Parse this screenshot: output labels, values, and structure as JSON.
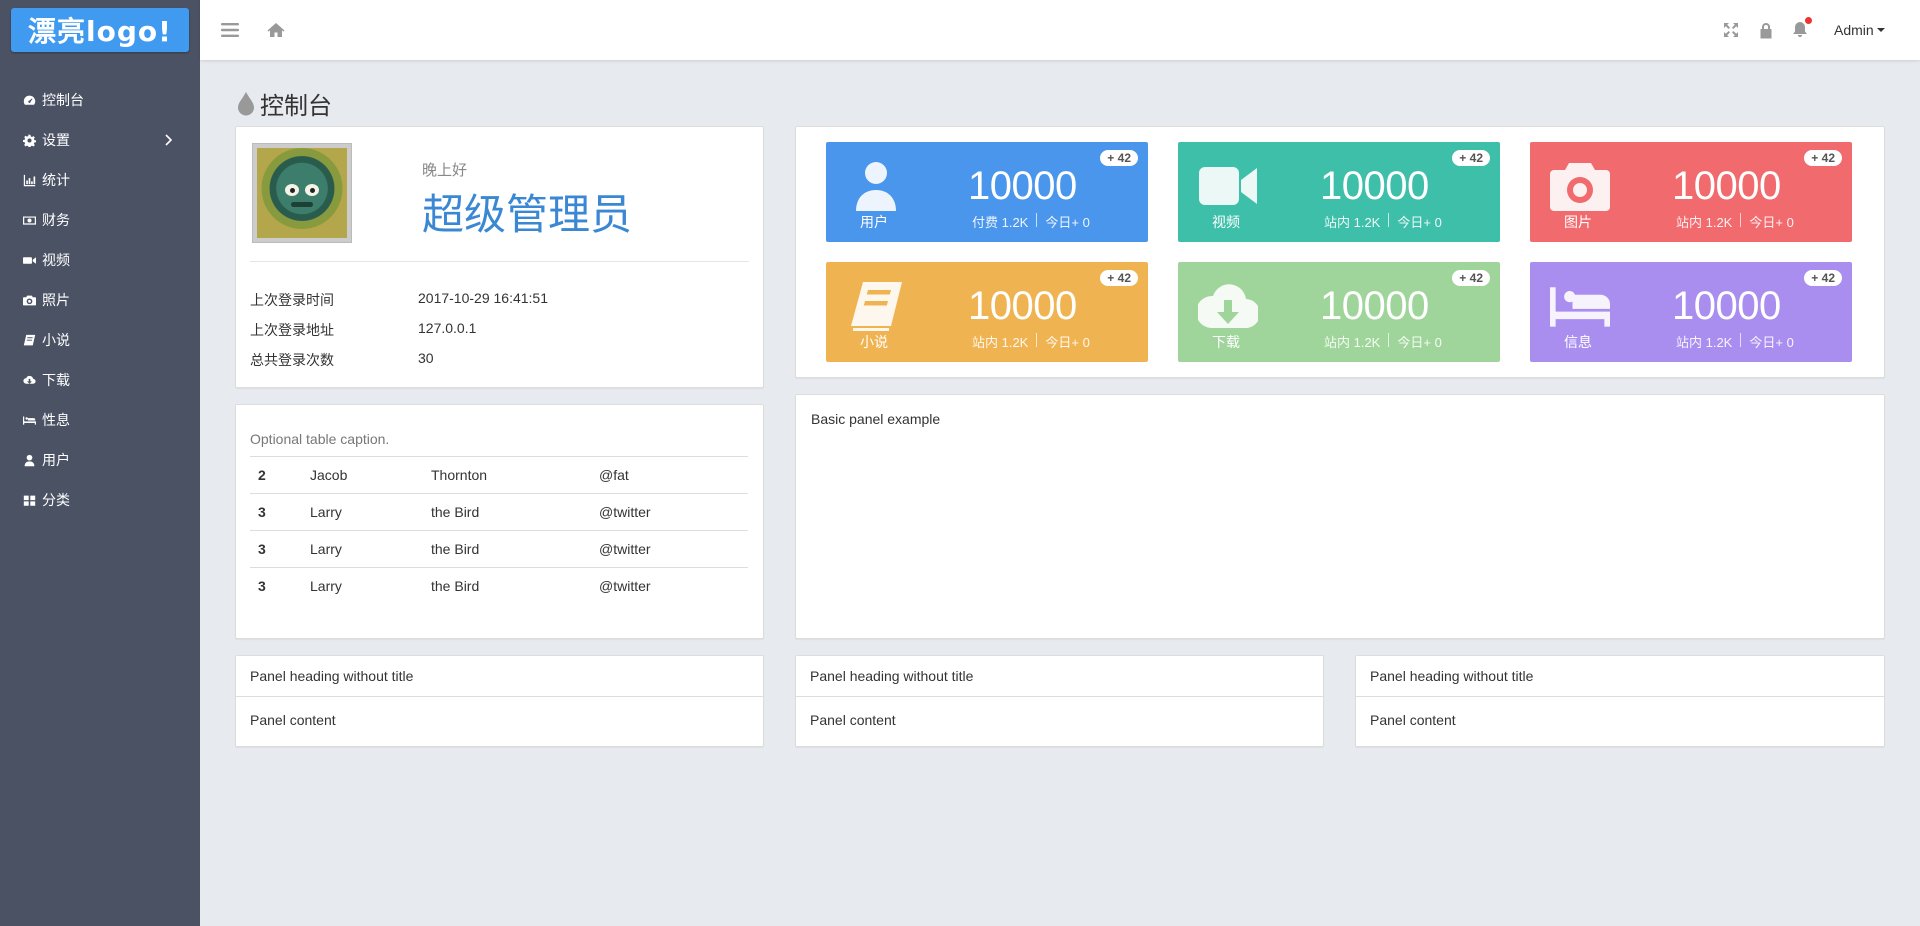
{
  "logo": {
    "text": "漂亮logo!"
  },
  "sidebar": {
    "items": [
      {
        "label": "控制台",
        "icon": "dashboard-icon"
      },
      {
        "label": "设置",
        "icon": "gear-icon"
      },
      {
        "label": "统计",
        "icon": "bar-chart-icon"
      },
      {
        "label": "财务",
        "icon": "money-icon"
      },
      {
        "label": "视频",
        "icon": "video-camera-icon"
      },
      {
        "label": "照片",
        "icon": "camera-icon"
      },
      {
        "label": "小说",
        "icon": "book-icon"
      },
      {
        "label": "下载",
        "icon": "cloud-download-icon"
      },
      {
        "label": "性息",
        "icon": "bed-icon"
      },
      {
        "label": "用户",
        "icon": "user-icon"
      },
      {
        "label": "分类",
        "icon": "grid-icon"
      }
    ]
  },
  "topbar": {
    "admin_label": "Admin"
  },
  "page": {
    "title": "控制台"
  },
  "profile": {
    "greeting": "晚上好",
    "role": "超级管理员",
    "rows": [
      {
        "key": "上次登录时间",
        "value": "2017-10-29 16:41:51"
      },
      {
        "key": "上次登录地址",
        "value": "127.0.0.1"
      },
      {
        "key": "总共登录次数",
        "value": "30"
      }
    ]
  },
  "tiles": [
    {
      "label": "用户",
      "value": "10000",
      "sub_left": "付费 1.2K",
      "sub_right": "今日+ 0",
      "badge": "+ 42",
      "color": "#4a96ec"
    },
    {
      "label": "视频",
      "value": "10000",
      "sub_left": "站内 1.2K",
      "sub_right": "今日+ 0",
      "badge": "+ 42",
      "color": "#3ebfaa"
    },
    {
      "label": "图片",
      "value": "10000",
      "sub_left": "站内 1.2K",
      "sub_right": "今日+ 0",
      "badge": "+ 42",
      "color": "#f06a6e"
    },
    {
      "label": "小说",
      "value": "10000",
      "sub_left": "站内 1.2K",
      "sub_right": "今日+ 0",
      "badge": "+ 42",
      "color": "#f0b351"
    },
    {
      "label": "下载",
      "value": "10000",
      "sub_left": "站内 1.2K",
      "sub_right": "今日+ 0",
      "badge": "+ 42",
      "color": "#9fd59a"
    },
    {
      "label": "信息",
      "value": "10000",
      "sub_left": "站内 1.2K",
      "sub_right": "今日+ 0",
      "badge": "+ 42",
      "color": "#a98ef0"
    }
  ],
  "table": {
    "caption": "Optional table caption.",
    "rows": [
      [
        "2",
        "Jacob",
        "Thornton",
        "@fat"
      ],
      [
        "3",
        "Larry",
        "the Bird",
        "@twitter"
      ],
      [
        "3",
        "Larry",
        "the Bird",
        "@twitter"
      ],
      [
        "3",
        "Larry",
        "the Bird",
        "@twitter"
      ]
    ]
  },
  "basic_panel": {
    "text": "Basic panel example"
  },
  "heading_panels": [
    {
      "heading": "Panel heading without title",
      "content": "Panel content"
    },
    {
      "heading": "Panel heading without title",
      "content": "Panel content"
    },
    {
      "heading": "Panel heading without title",
      "content": "Panel content"
    }
  ]
}
